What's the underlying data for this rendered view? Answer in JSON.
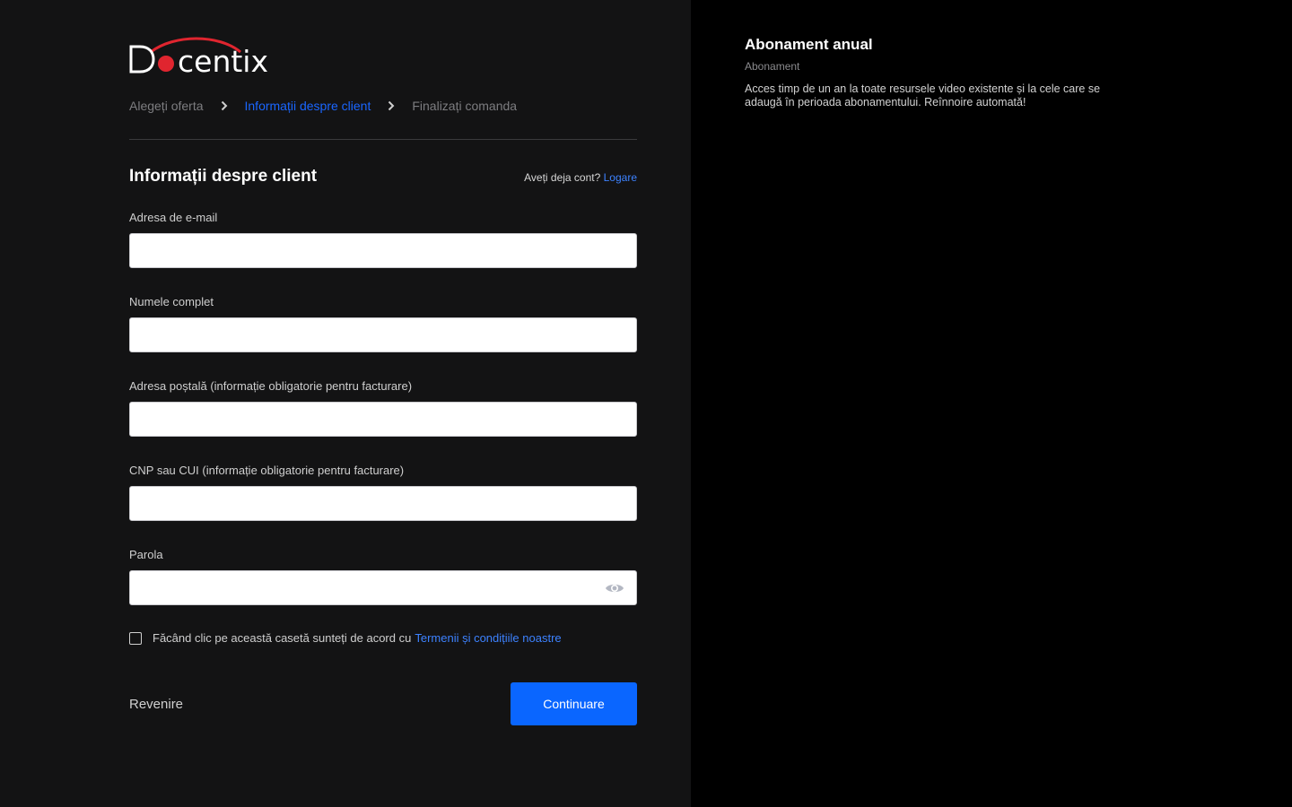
{
  "brand": {
    "name": "Docentix",
    "accent_color": "#e0252f"
  },
  "breadcrumb": [
    {
      "label": "Alegeți oferta",
      "state": "done"
    },
    {
      "label": "Informații despre client",
      "state": "active"
    },
    {
      "label": "Finalizați comanda",
      "state": "pending"
    }
  ],
  "form": {
    "title": "Informații despre client",
    "login_prompt": "Aveți deja cont?",
    "login_link": "Logare",
    "fields": {
      "email": {
        "label": "Adresa de e-mail",
        "value": ""
      },
      "full_name": {
        "label": "Numele complet",
        "value": ""
      },
      "address": {
        "label": "Adresa poștală (informație obligatorie pentru facturare)",
        "value": ""
      },
      "cnp": {
        "label": "CNP sau CUI (informație obligatorie pentru facturare)",
        "value": ""
      },
      "password": {
        "label": "Parola",
        "value": "",
        "icon": "eye-icon"
      }
    },
    "terms": {
      "checked": false,
      "text": "Făcând clic pe această casetă sunteți de acord cu",
      "link": "Termenii și condițiile noastre"
    },
    "back_label": "Revenire",
    "continue_label": "Continuare",
    "primary_color": "#0a66ff"
  },
  "plan": {
    "title": "Abonament anual",
    "type": "Abonament",
    "description": "Acces timp de un an la toate resursele video existente și la cele care se adaugă în perioada abonamentului. Reînnoire automată!"
  }
}
